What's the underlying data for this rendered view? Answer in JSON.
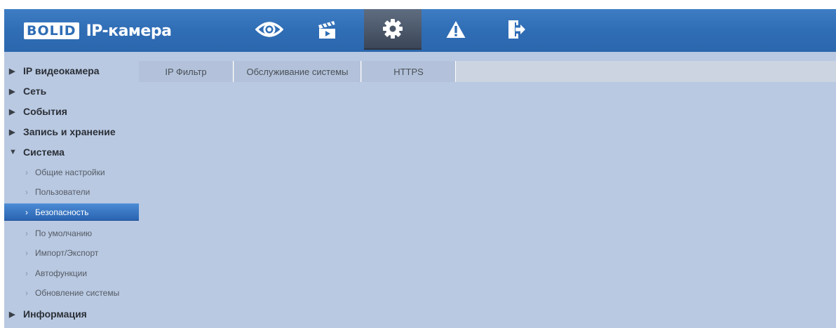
{
  "header": {
    "logo_text": "BOLID",
    "app_title": "IP-камера",
    "icons": [
      "eye-icon",
      "clapper-icon",
      "gear-icon",
      "warning-icon",
      "logout-icon"
    ],
    "active_icon": "gear-icon"
  },
  "sidebar": {
    "groups": [
      {
        "label": "IP видеокамера",
        "expanded": false
      },
      {
        "label": "Сеть",
        "expanded": false
      },
      {
        "label": "События",
        "expanded": false
      },
      {
        "label": "Запись и хранение",
        "expanded": false
      },
      {
        "label": "Система",
        "expanded": true
      },
      {
        "label": "Информация",
        "expanded": false
      }
    ],
    "sub_items": [
      {
        "label": "Общие настройки"
      },
      {
        "label": "Пользователи"
      },
      {
        "label": "Безопасность",
        "active": true
      },
      {
        "label": "По умолчанию"
      },
      {
        "label": "Импорт/Экспорт"
      },
      {
        "label": "Автофункции"
      },
      {
        "label": "Обновление системы"
      }
    ],
    "arrow_collapsed": "▶",
    "arrow_expanded": "▼",
    "chevron": "›"
  },
  "tabs": [
    {
      "label": "IP Фильтр"
    },
    {
      "label": "Обслуживание системы"
    },
    {
      "label": "HTTPS"
    }
  ],
  "colors": {
    "header_blue": "#2f6db5",
    "content_bg": "#b9c9e2",
    "active_item": "#3575c4"
  }
}
